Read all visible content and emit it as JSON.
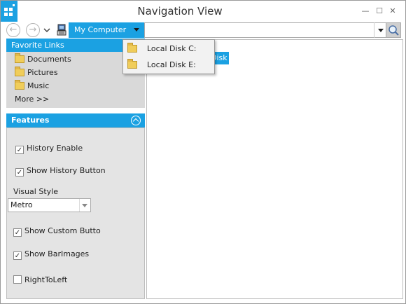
{
  "window": {
    "title": "Navigation View",
    "controls": {
      "minimize": "—",
      "maximize": "☐",
      "close": "✕"
    }
  },
  "navbar": {
    "back_icon": "←",
    "forward_icon": "→",
    "history_icon": "chevron-down-icon",
    "computer_icon": "computer-icon",
    "breadcrumb_label": "My Computer",
    "address_value": "",
    "search_icon": "search-icon"
  },
  "popup": {
    "items": [
      {
        "label": "Local Disk C:",
        "icon": "folder-icon"
      },
      {
        "label": "Local Disk E:",
        "icon": "folder-icon"
      }
    ]
  },
  "content": {
    "selected_item_text": "Disk"
  },
  "favorites": {
    "header": "Favorite Links",
    "items": [
      {
        "label": "Documents",
        "icon": "folder-icon"
      },
      {
        "label": "Pictures",
        "icon": "folder-icon"
      },
      {
        "label": "Music",
        "icon": "folder-icon"
      }
    ],
    "more": "More >>"
  },
  "features": {
    "header": "Features",
    "history_enable": {
      "label": "History Enable",
      "checked": true
    },
    "show_history_button": {
      "label": "Show History Button",
      "checked": true
    },
    "visual_style_label": "Visual Style",
    "visual_style_value": "Metro",
    "show_custom_button": {
      "label": "Show Custom Butto",
      "checked": true
    },
    "show_bar_images": {
      "label": "Show BarImages",
      "checked": true
    },
    "right_to_left": {
      "label": "RightToLeft",
      "checked": false
    }
  },
  "colors": {
    "accent": "#1ba1e2",
    "panel_bg": "#d9d9d9",
    "features_bg": "#e4e4e4"
  }
}
